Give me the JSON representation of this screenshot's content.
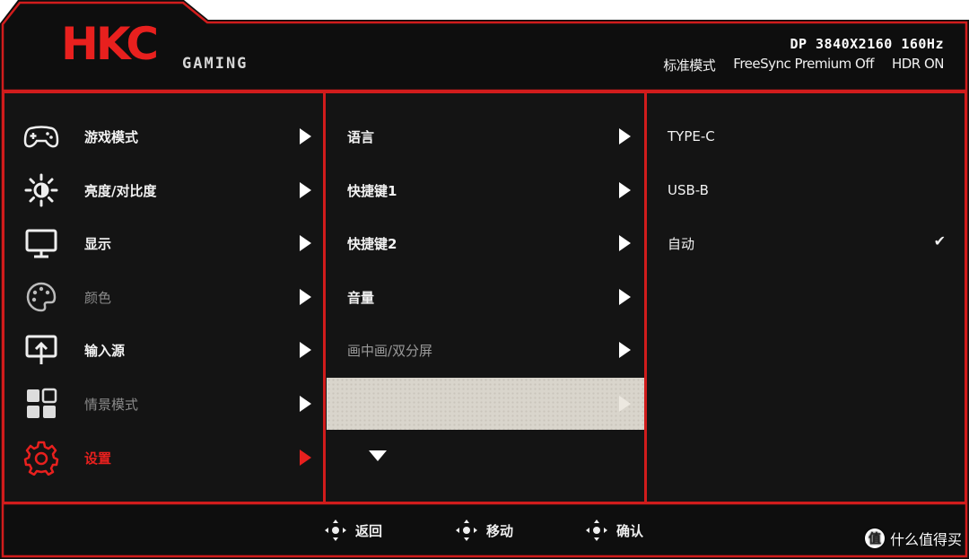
{
  "brand": {
    "logo": "HKC",
    "sub": "GAMING",
    "accent": "#e8201e"
  },
  "status": {
    "signal": "DP 3840X2160 160Hz",
    "mode": "标准模式",
    "freesync": "FreeSync Premium Off",
    "hdr": "HDR ON"
  },
  "main_menu": [
    {
      "label": "游戏模式",
      "icon": "gamepad-icon",
      "state": "normal"
    },
    {
      "label": "亮度/对比度",
      "icon": "sun-icon",
      "state": "normal"
    },
    {
      "label": "显示",
      "icon": "monitor-icon",
      "state": "normal"
    },
    {
      "label": "颜色",
      "icon": "palette-icon",
      "state": "dim"
    },
    {
      "label": "输入源",
      "icon": "input-source-icon",
      "state": "normal"
    },
    {
      "label": "情景模式",
      "icon": "grid-icon",
      "state": "dim"
    },
    {
      "label": "设置",
      "icon": "gear-icon",
      "state": "active"
    }
  ],
  "sub_menu": [
    {
      "label": "语言",
      "state": "normal"
    },
    {
      "label": "快捷键1",
      "state": "normal"
    },
    {
      "label": "快捷键2",
      "state": "normal"
    },
    {
      "label": "音量",
      "state": "normal"
    },
    {
      "label": "画中画/双分屏",
      "state": "dim"
    }
  ],
  "options": [
    {
      "label": "TYPE-C",
      "checked": false
    },
    {
      "label": "USB-B",
      "checked": false
    },
    {
      "label": "自动",
      "checked": true
    }
  ],
  "check_glyph": "✔",
  "footer": {
    "back": "返回",
    "move": "移动",
    "confirm": "确认"
  },
  "watermark": {
    "badge": "值",
    "text": "什么值得买"
  }
}
